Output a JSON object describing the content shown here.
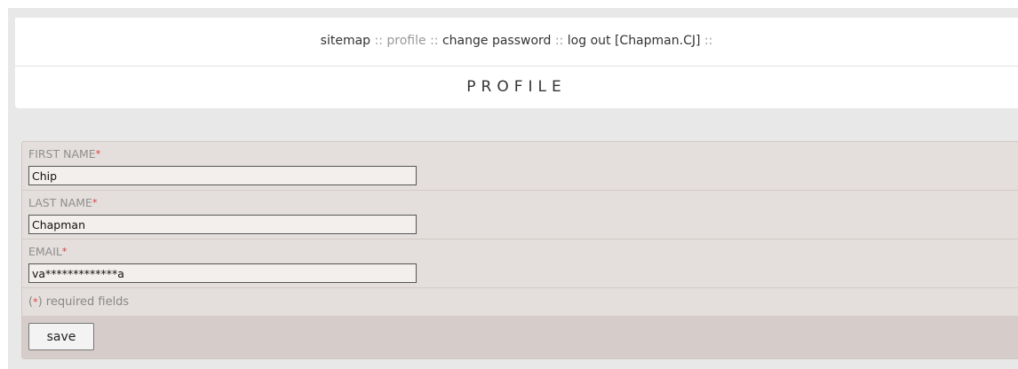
{
  "nav": {
    "items": [
      {
        "label": "sitemap",
        "active": false
      },
      {
        "label": "profile",
        "active": true
      },
      {
        "label": "change password",
        "active": false
      },
      {
        "label": "log out [Chapman.CJ]",
        "active": false
      }
    ],
    "separator": "::"
  },
  "page": {
    "title": "PROFILE"
  },
  "form": {
    "required_marker": "*",
    "fields": [
      {
        "label": "FIRST NAME",
        "value": "Chip"
      },
      {
        "label": "LAST NAME",
        "value": "Chapman"
      },
      {
        "label": "EMAIL",
        "value": "va*************a"
      }
    ],
    "required_note_open": "(",
    "required_note_close": ") required fields",
    "save_label": "save"
  },
  "colors": {
    "required_star": "#e23b3b",
    "active_nav": "#999999",
    "form_background": "#e4dfdc",
    "action_bar": "#d6cdca"
  }
}
